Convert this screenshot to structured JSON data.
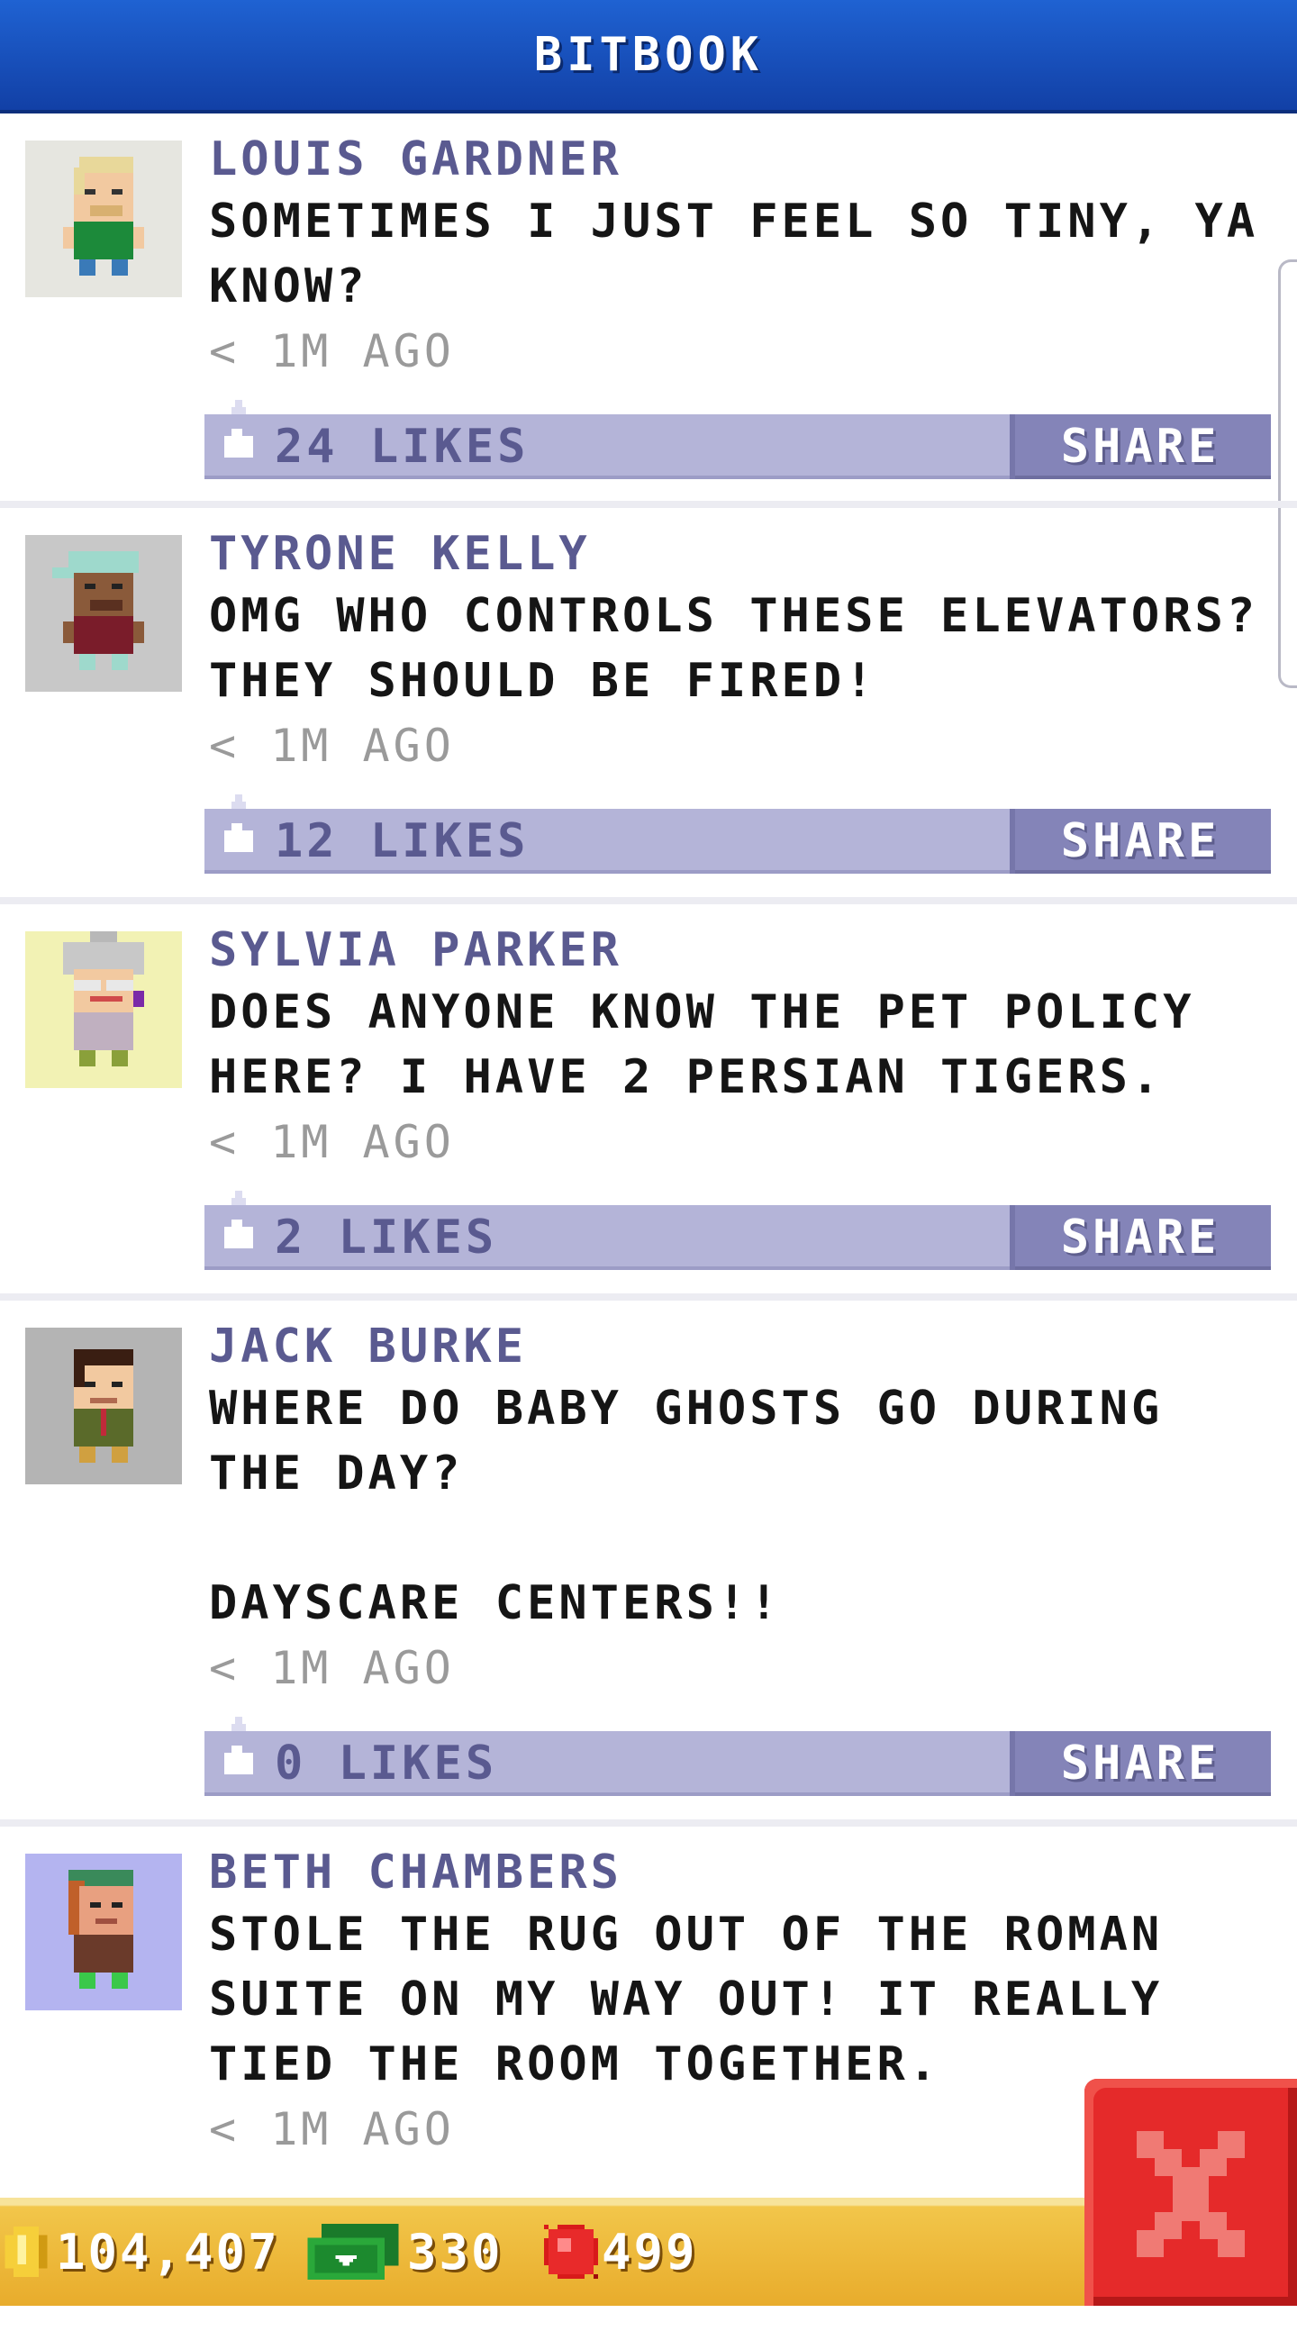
{
  "header": {
    "title": "BITBOOK"
  },
  "posts": [
    {
      "author": "LOUIS GARDNER",
      "message": "SOMETIMES I JUST FEEL SO TINY, YA KNOW?",
      "time": "< 1M AGO",
      "likes": "24 LIKES",
      "share_label": "SHARE",
      "avatar_bg": "#e6e6e0"
    },
    {
      "author": "TYRONE KELLY",
      "message": "OMG WHO CONTROLS THESE ELEVATORS? THEY SHOULD BE FIRED!",
      "time": "< 1M AGO",
      "likes": "12 LIKES",
      "share_label": "SHARE",
      "avatar_bg": "#c8c8c8"
    },
    {
      "author": "SYLVIA PARKER",
      "message": "DOES ANYONE KNOW THE PET POLICY HERE? I HAVE 2 PERSIAN TIGERS.",
      "time": "< 1M AGO",
      "likes": "2 LIKES",
      "share_label": "SHARE",
      "avatar_bg": "#f2f2b4"
    },
    {
      "author": "JACK BURKE",
      "message": "WHERE DO BABY GHOSTS GO DURING THE DAY?\n\nDAYSCARE CENTERS!!",
      "time": "< 1M AGO",
      "likes": "0 LIKES",
      "share_label": "SHARE",
      "avatar_bg": "#b4b4b4"
    },
    {
      "author": "BETH CHAMBERS",
      "message": "STOLE THE RUG OUT OF THE ROMAN SUITE ON MY WAY OUT! IT REALLY TIED THE ROOM TOGETHER.",
      "time": "< 1M AGO",
      "avatar_bg": "#b4b4f0"
    }
  ],
  "bottom_bar": {
    "coins": "104,407",
    "bux": "330",
    "gems": "499"
  },
  "colors": {
    "header": "#1a52c0",
    "author": "#5a5a90",
    "action_bar": "#b4b4d8",
    "share_button": "#8484b8",
    "close_button": "#e52a2a",
    "bottom_bar": "#f2c64a"
  },
  "icons": {
    "like": "like-thumb-icon",
    "coin": "coin-icon",
    "bux": "bux-bill-icon",
    "gem": "gem-icon",
    "close": "close-x-icon"
  }
}
